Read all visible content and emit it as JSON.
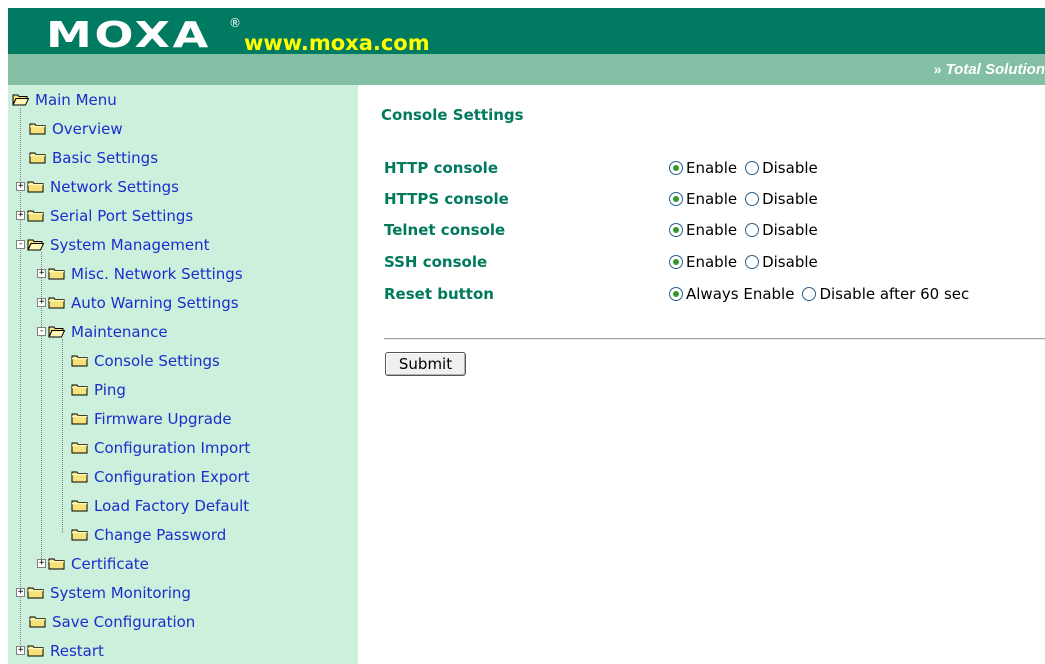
{
  "header": {
    "logo_text": "MOXA",
    "logo_registered": "®",
    "url": "www.moxa.com",
    "tagline_arrows": "»",
    "tagline": "Total Solution"
  },
  "sidebar": {
    "items": [
      {
        "label": "Main Menu",
        "icon": "open-folder-icon",
        "expander": ""
      },
      {
        "label": "Overview",
        "icon": "folder-icon",
        "expander": ""
      },
      {
        "label": "Basic Settings",
        "icon": "folder-icon",
        "expander": ""
      },
      {
        "label": "Network Settings",
        "icon": "folder-icon",
        "expander": "+"
      },
      {
        "label": "Serial Port Settings",
        "icon": "folder-icon",
        "expander": "+"
      },
      {
        "label": "System Management",
        "icon": "open-folder-icon",
        "expander": "-"
      },
      {
        "label": "Misc. Network Settings",
        "icon": "folder-icon",
        "expander": "+"
      },
      {
        "label": "Auto Warning Settings",
        "icon": "folder-icon",
        "expander": "+"
      },
      {
        "label": "Maintenance",
        "icon": "open-folder-icon",
        "expander": "-"
      },
      {
        "label": "Console Settings",
        "icon": "folder-icon",
        "expander": ""
      },
      {
        "label": "Ping",
        "icon": "folder-icon",
        "expander": ""
      },
      {
        "label": "Firmware Upgrade",
        "icon": "folder-icon",
        "expander": ""
      },
      {
        "label": "Configuration Import",
        "icon": "folder-icon",
        "expander": ""
      },
      {
        "label": "Configuration Export",
        "icon": "folder-icon",
        "expander": ""
      },
      {
        "label": "Load Factory Default",
        "icon": "folder-icon",
        "expander": ""
      },
      {
        "label": "Change Password",
        "icon": "folder-icon",
        "expander": ""
      },
      {
        "label": "Certificate",
        "icon": "folder-icon",
        "expander": "+"
      },
      {
        "label": "System Monitoring",
        "icon": "folder-icon",
        "expander": "+"
      },
      {
        "label": "Save Configuration",
        "icon": "folder-icon",
        "expander": ""
      },
      {
        "label": "Restart",
        "icon": "folder-icon",
        "expander": "+"
      }
    ]
  },
  "main": {
    "title": "Console Settings",
    "settings": [
      {
        "label": "HTTP console",
        "options": [
          "Enable",
          "Disable"
        ],
        "selected": "Enable"
      },
      {
        "label": "HTTPS console",
        "options": [
          "Enable",
          "Disable"
        ],
        "selected": "Enable"
      },
      {
        "label": "Telnet console",
        "options": [
          "Enable",
          "Disable"
        ],
        "selected": "Enable"
      },
      {
        "label": "SSH console",
        "options": [
          "Enable",
          "Disable"
        ],
        "selected": "Enable"
      },
      {
        "label": "Reset button",
        "options": [
          "Always Enable",
          "Disable after 60 sec"
        ],
        "selected": "Always Enable"
      }
    ],
    "submit_label": "Submit"
  },
  "colors": {
    "header_dark": "#007a60",
    "header_light": "#82bfa5",
    "sidebar_bg": "#ccf0dc",
    "link_blue": "#1a2ecc",
    "label_green": "#00795c",
    "url_yellow": "#ffff00"
  }
}
